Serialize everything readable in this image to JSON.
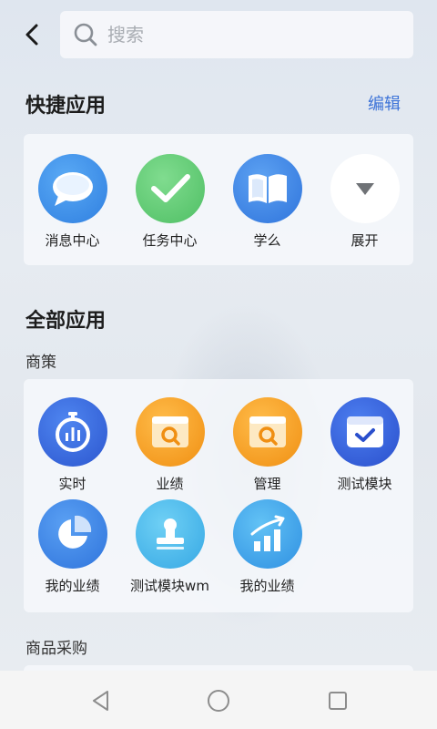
{
  "header": {
    "back_icon": "chevron-left-icon",
    "search_placeholder": "搜索"
  },
  "quick_apps": {
    "title": "快捷应用",
    "edit_label": "编辑",
    "items": [
      {
        "label": "消息中心",
        "icon": "chat-bubble-icon",
        "color": "#3d8fe8"
      },
      {
        "label": "任务中心",
        "icon": "check-icon",
        "color": "#5cc56f"
      },
      {
        "label": "学么",
        "icon": "book-icon",
        "color": "#3d86e6"
      },
      {
        "label": "展开",
        "icon": "triangle-down-icon",
        "color": "#ffffff"
      }
    ]
  },
  "all_apps": {
    "title": "全部应用",
    "groups": [
      {
        "name": "商策",
        "items": [
          {
            "label": "实时",
            "icon": "stopwatch-icon",
            "color": "#3d6fe0"
          },
          {
            "label": "业绩",
            "icon": "box-search-icon",
            "color": "#f4a020"
          },
          {
            "label": "管理",
            "icon": "box-search-icon",
            "color": "#f4a020"
          },
          {
            "label": "测试模块",
            "icon": "calendar-check-icon",
            "color": "#3a63df"
          },
          {
            "label": "我的业绩",
            "icon": "pie-chart-icon",
            "color": "#3d86e6"
          },
          {
            "label": "测试模块wm",
            "icon": "stamp-icon",
            "color": "#4cb8ea"
          },
          {
            "label": "我的业绩",
            "icon": "bar-growth-icon",
            "color": "#3aa6ea"
          }
        ]
      },
      {
        "name": "商品采购",
        "items": []
      }
    ]
  },
  "navbar": {
    "back": "nav-back-icon",
    "home": "nav-home-icon",
    "recent": "nav-recent-icon"
  }
}
